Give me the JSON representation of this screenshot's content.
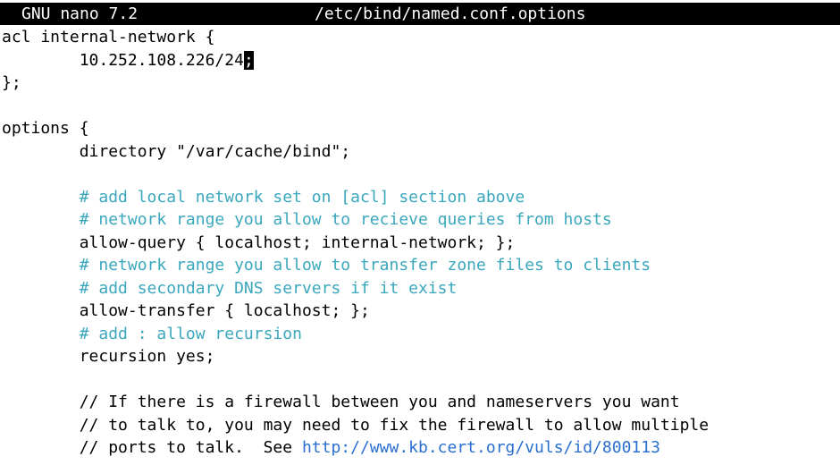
{
  "titlebar": {
    "app": "GNU nano 7.2",
    "file": "/etc/bind/named.conf.options"
  },
  "editor": {
    "lines": {
      "l0": "acl internal-network {",
      "l1_pre": "        10.252.108.226/24",
      "l1_cursor": ";",
      "l2": "};",
      "l3": "",
      "l4": "options {",
      "l5": "        directory \"/var/cache/bind\";",
      "l6": "",
      "l7": "        # add local network set on [acl] section above",
      "l8": "        # network range you allow to recieve queries from hosts",
      "l9": "        allow-query { localhost; internal-network; };",
      "l10": "        # network range you allow to transfer zone files to clients",
      "l11": "        # add secondary DNS servers if it exist",
      "l12": "        allow-transfer { localhost; };",
      "l13": "        # add : allow recursion",
      "l14": "        recursion yes;",
      "l15": "",
      "l16": "        // If there is a firewall between you and nameservers you want",
      "l17": "        // to talk to, you may need to fix the firewall to allow multiple",
      "l18_pre": "        // ports to talk.  See ",
      "l18_url": "http://www.kb.cert.org/vuls/id/800113"
    }
  },
  "colors": {
    "comment": "#3aa7bd",
    "url": "#2a6fd0",
    "titlebar_bg": "#000000",
    "background": "#ffffff"
  }
}
